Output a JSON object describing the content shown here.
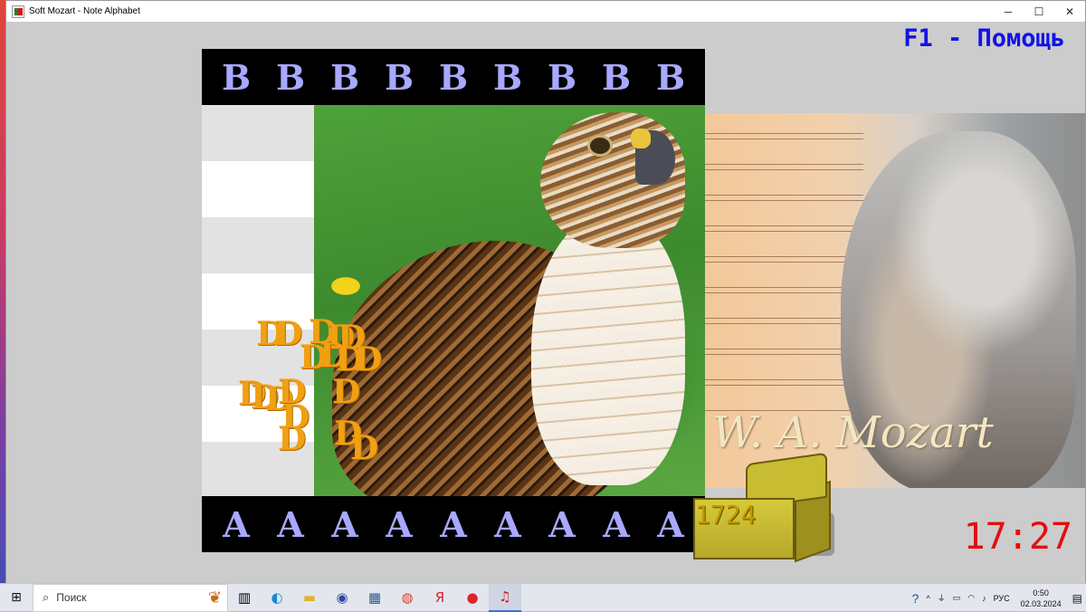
{
  "window": {
    "title": "Soft Mozart - Note Alphabet",
    "minimize": "─",
    "maximize": "☐",
    "close": "✕"
  },
  "help_label": "F1 - Помощь",
  "top_row_notes": [
    "B",
    "B",
    "B",
    "B",
    "B",
    "B",
    "B",
    "B",
    "B"
  ],
  "bottom_row_notes": [
    "A",
    "A",
    "A",
    "A",
    "A",
    "A",
    "A",
    "A",
    "A"
  ],
  "falling_notes": [
    {
      "label": "D"
    },
    {
      "label": "D"
    },
    {
      "label": "D"
    },
    {
      "label": "D"
    },
    {
      "label": "D"
    },
    {
      "label": "D"
    },
    {
      "label": "D"
    },
    {
      "label": "D"
    },
    {
      "label": "D"
    },
    {
      "label": "D"
    },
    {
      "label": "D"
    },
    {
      "label": "D"
    },
    {
      "label": "D"
    },
    {
      "label": "D"
    },
    {
      "label": "D"
    },
    {
      "label": "D"
    },
    {
      "label": "D"
    },
    {
      "label": "D"
    }
  ],
  "staff_colors": [
    "#e2e2e2",
    "#ffffff",
    "#e2e2e2",
    "#ffffff",
    "#e2e2e2",
    "#ffffff",
    "#e2e2e2"
  ],
  "signature": "W. A. Mozart",
  "score": "1724",
  "timer": "17:27",
  "taskbar": {
    "search_placeholder": "Поиск",
    "icons": [
      "task-view-icon",
      "edge-icon",
      "file-explorer-icon",
      "app-icon-1",
      "calculator-icon",
      "chrome-icon",
      "yandex-icon",
      "yandex-browser-icon",
      "soft-mozart-icon"
    ],
    "language": "РУС",
    "time": "0:50",
    "date": "02.03.2024"
  },
  "colors": {
    "help_blue": "#1212e6",
    "note_lavender": "#a8a8ff",
    "falling_orange": "#f0a012",
    "timer_red": "#e40e0e"
  }
}
